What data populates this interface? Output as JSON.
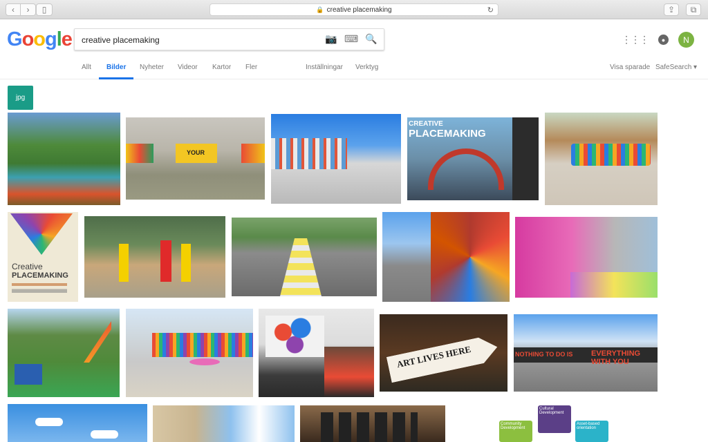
{
  "browser": {
    "url": "creative placemaking",
    "back_icon": "‹",
    "forward_icon": "›",
    "sidebar_icon": "▯",
    "lock_icon": "🔒",
    "reload_icon": "↻",
    "share_icon": "⇪",
    "tabs_icon": "⧉"
  },
  "google": {
    "logo": {
      "letters": [
        "G",
        "o",
        "o",
        "g",
        "l",
        "e"
      ],
      "colors": [
        "#4285F4",
        "#EA4335",
        "#FBBC05",
        "#4285F4",
        "#34A853",
        "#EA4335"
      ]
    },
    "search": {
      "value": "creative placemaking",
      "camera_icon": "📷",
      "keyboard_icon": "⌨",
      "search_icon": "🔍"
    },
    "apps_icon": "⋮⋮⋮",
    "notif_icon": "🔔",
    "avatar_letter": "N"
  },
  "tabs": {
    "all": "Allt",
    "images": "Bilder",
    "news": "Nyheter",
    "videos": "Videor",
    "maps": "Kartor",
    "more": "Fler",
    "settings": "Inställningar",
    "tools": "Verktyg",
    "saved": "Visa sparade",
    "safesearch": "SafeSearch ▾"
  },
  "chip": {
    "label": "jpg"
  },
  "thumbnails": {
    "book_creative": "CREATIVE",
    "book_placemaking": "PLACEMAKING",
    "book2_creative": "Creative",
    "book2_placemaking": "PLACEMAKING",
    "wall_your": "YOUR",
    "art_lives_here": "ART LIVES HERE",
    "nothing_to_do": "NOTHING TO DO IS",
    "everything_with": "EVERYTHING WITH YOU",
    "diag_cultural": "Cultural Development",
    "diag_community": "Community Development",
    "diag_asset": "Asset-based orientation"
  },
  "colors": {
    "accent": "#1a73e8",
    "chip": "#1a9c87",
    "avatar": "#7cb342"
  }
}
